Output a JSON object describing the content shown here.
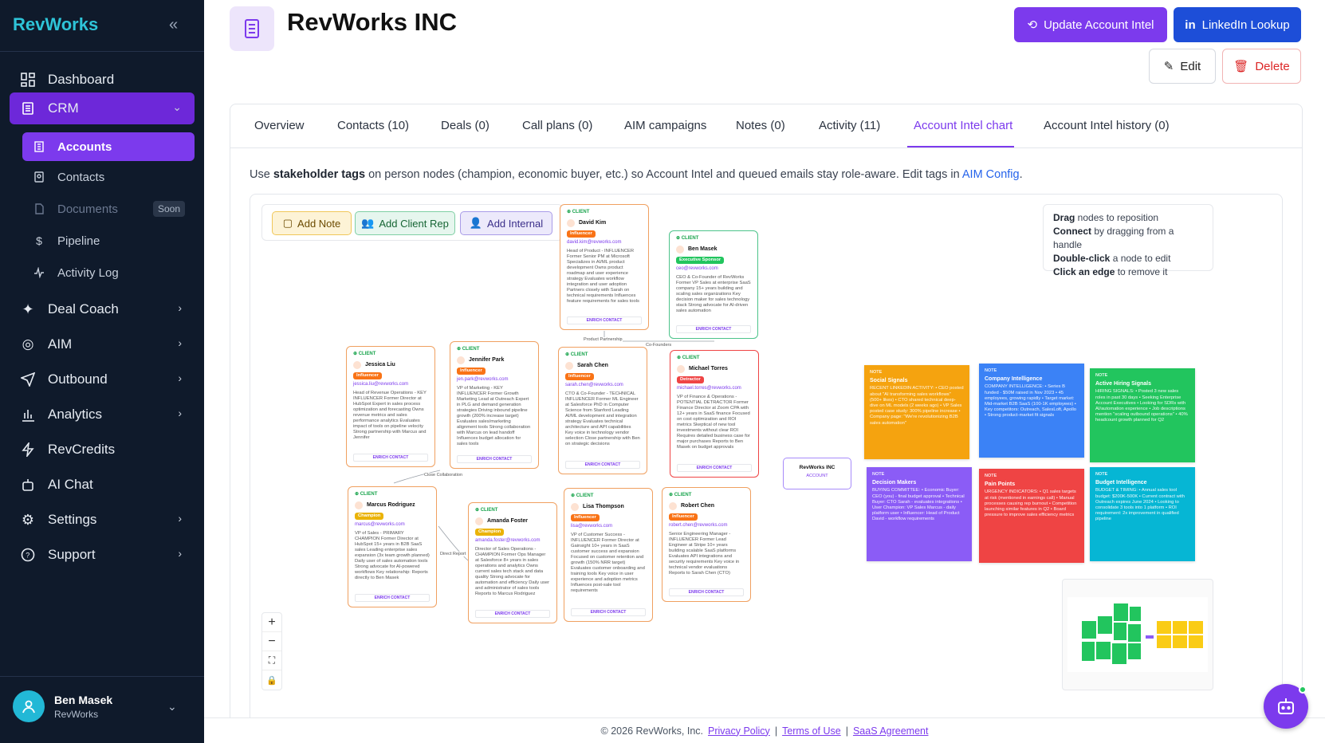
{
  "app": {
    "name": "RevWorks",
    "collapse_icon": "chevrons-left-icon"
  },
  "sidebar": {
    "items": [
      {
        "label": "Dashboard",
        "icon": "dashboard-icon"
      },
      {
        "label": "CRM",
        "icon": "crm-icon",
        "expanded": true
      },
      {
        "label": "Deal Coach",
        "icon": "sparkles-icon"
      },
      {
        "label": "AIM",
        "icon": "aim-icon"
      },
      {
        "label": "Outbound",
        "icon": "send-icon"
      },
      {
        "label": "Analytics",
        "icon": "bar-chart-icon"
      },
      {
        "label": "RevCredits",
        "icon": "bolt-icon"
      },
      {
        "label": "AI Chat",
        "icon": "bot-icon"
      },
      {
        "label": "Settings",
        "icon": "gear-icon"
      },
      {
        "label": "Support",
        "icon": "help-circle-icon"
      }
    ],
    "crm_sub": [
      {
        "label": "Accounts",
        "active": true
      },
      {
        "label": "Contacts"
      },
      {
        "label": "Documents",
        "badge": "Soon"
      },
      {
        "label": "Pipeline"
      },
      {
        "label": "Activity Log"
      }
    ],
    "user": {
      "name": "Ben Masek",
      "org": "RevWorks"
    }
  },
  "header": {
    "title": "RevWorks INC",
    "update_btn": "Update Account Intel",
    "linkedin_btn": "LinkedIn Lookup",
    "edit_btn": "Edit",
    "delete_btn": "Delete"
  },
  "tabs": [
    "Overview",
    "Contacts (10)",
    "Deals (0)",
    "Call plans (0)",
    "AIM campaigns",
    "Notes (0)",
    "Activity (11)",
    "Account Intel chart",
    "Account Intel history (0)"
  ],
  "active_tab": "Account Intel chart",
  "description": {
    "pre": "Use ",
    "bold": "stakeholder tags",
    "mid": " on person nodes (champion, economic buyer, etc.) so Account Intel and queued emails stay role-aware. Edit tags in ",
    "link": "AIM Config",
    "post": "."
  },
  "toolbar": {
    "add_note": "Add Note",
    "add_client": "Add Client Rep",
    "add_internal": "Add Internal"
  },
  "help": {
    "l1b": "Drag",
    "l1": " nodes to reposition",
    "l2b": "Connect",
    "l2": " by dragging from a handle",
    "l3b": "Double-click",
    "l3": " a node to edit",
    "l4b": "Click an edge",
    "l4": " to remove it"
  },
  "account_node": {
    "name": "RevWorks INC",
    "label": "ACCOUNT"
  },
  "edges": {
    "product_partnership": "Product Partnership",
    "co_founders": "Co-Founders",
    "close_collab": "Close Collaboration",
    "direct_report": "Direct Report"
  },
  "nodes": {
    "david": {
      "tag": "CLIENT",
      "name": "David Kim",
      "role": "Influencer",
      "email": "david.kim@revworks.com",
      "body": "Head of Product - INFLUENCER Former Senior PM at Microsoft Specializes in AI/ML product development Owns product roadmap and user experience strategy Evaluates workflow integration and user adoption Partners closely with Sarah on technical requirements Influences feature requirements for sales tools",
      "enrich": "ENRICH CONTACT"
    },
    "ben": {
      "tag": "CLIENT",
      "name": "Ben Masek",
      "role": "Executive Sponsor",
      "email": "ceo@revworks.com",
      "body": "CEO & Co-Founder of RevWorks Former VP Sales at enterprise SaaS company 15+ years building and scaling sales organizations Key decision maker for sales technology stack Strong advocate for AI-driven sales automation",
      "enrich": "ENRICH CONTACT"
    },
    "jessica": {
      "tag": "CLIENT",
      "name": "Jessica Liu",
      "role": "Influencer",
      "email": "jessica.liu@revworks.com",
      "body": "Head of Revenue Operations - KEY INFLUENCER Former Director at HubSpot Expert in sales process optimization and forecasting Owns revenue metrics and sales performance analytics Evaluates impact of tools on pipeline velocity Strong partnership with Marcus and Jennifer",
      "enrich": "ENRICH CONTACT"
    },
    "jennifer": {
      "tag": "CLIENT",
      "name": "Jennifer Park",
      "role": "Influencer",
      "email": "jen.park@revworks.com",
      "body": "VP of Marketing - KEY INFLUENCER Former Growth Marketing Lead at Outreach Expert in PLG and demand generation strategies Driving inbound pipeline growth (200% increase target) Evaluates sales/marketing alignment tools Strong collaboration with Marcus on lead handoff Influences budget allocation for sales tools",
      "enrich": "ENRICH CONTACT"
    },
    "sarah": {
      "tag": "CLIENT",
      "name": "Sarah Chen",
      "role": "Influencer",
      "email": "sarah.chen@revworks.com",
      "body": "CTO & Co-Founder - TECHNICAL INFLUENCER Former ML Engineer at Salesforce PhD in Computer Science from Stanford Leading AI/ML development and integration strategy Evaluates technical architecture and API capabilities Key voice in technology vendor selection Close partnership with Ben on strategic decisions",
      "enrich": "ENRICH CONTACT"
    },
    "michael": {
      "tag": "CLIENT",
      "name": "Michael Torres",
      "role": "Detractor",
      "email": "michael.torres@revworks.com",
      "body": "VP of Finance & Operations - POTENTIAL DETRACTOR Former Finance Director at Zoom CPA with 12+ years in SaaS finance Focused on cost optimization and ROI metrics Skeptical of new tool investments without clear ROI Requires detailed business case for major purchases Reports to Ben Masek on budget approvals",
      "enrich": "ENRICH CONTACT"
    },
    "marcus": {
      "tag": "CLIENT",
      "name": "Marcus Rodriguez",
      "role": "Champion",
      "email": "marcus@revworks.com",
      "body": "VP of Sales - PRIMARY CHAMPION Former Director at HubSpot 15+ years in B2B SaaS sales Leading enterprise sales expansion (3x team growth planned) Daily user of sales automation tools Strong advocate for AI-powered workflows Key relationship: Reports directly to Ben Masek",
      "enrich": "ENRICH CONTACT"
    },
    "amanda": {
      "tag": "CLIENT",
      "name": "Amanda Foster",
      "role": "Champion",
      "email": "amanda.foster@revworks.com",
      "body": "Director of Sales Operations - CHAMPION Former Ops Manager at Salesforce 8+ years in sales operations and analytics Owns current sales tech stack and data quality Strong advocate for automation and efficiency Daily user and administrator of sales tools Reports to Marcus Rodriguez",
      "enrich": "ENRICH CONTACT"
    },
    "lisa": {
      "tag": "CLIENT",
      "name": "Lisa Thompson",
      "role": "Influencer",
      "email": "lisa@revworks.com",
      "body": "VP of Customer Success - INFLUENCER Former Director at Gainsight 10+ years in SaaS customer success and expansion Focused on customer retention and growth (150% NRR target) Evaluates customer onboarding and training tools Key voice in user experience and adoption metrics Influences post-sale tool requirements",
      "enrich": "ENRICH CONTACT"
    },
    "robert": {
      "tag": "CLIENT",
      "name": "Robert Chen",
      "role": "Influencer",
      "email": "robert.chen@revworks.com",
      "body": "Senior Engineering Manager - INFLUENCER Former Lead Engineer at Stripe 10+ years building scalable SaaS platforms Evaluates API integrations and security requirements Key voice in technical vendor evaluations Reports to Sarah Chen (CTO)",
      "enrich": "ENRICH CONTACT"
    }
  },
  "notes": [
    {
      "tag": "NOTE",
      "title": "Social Signals",
      "color": "#f5a30f",
      "body": "RECENT LINKEDIN ACTIVITY: • CEO posted about \"AI transforming sales workflows\" (500+ likes) • CTO shared technical deep-dive on ML models (2 weeks ago) • VP Sales posted case study: 300% pipeline increase • Company page: \"We're revolutionizing B2B sales automation\""
    },
    {
      "tag": "NOTE",
      "title": "Company Intelligence",
      "color": "#3b82f6",
      "body": "COMPANY INTELLIGENCE: • Series B funded - $50M raised in Nov 2023 • 45 employees, growing rapidly • Target market: Mid-market B2B SaaS (100-1K employees) • Key competitors: Outreach, SalesLoft, Apollo • Strong product-market fit signals"
    },
    {
      "tag": "NOTE",
      "title": "Active Hiring Signals",
      "color": "#22c55e",
      "body": "HIRING SIGNALS: • Posted 3 new sales roles in past 30 days • Seeking Enterprise Account Executives • Looking for SDRs with AI/automation experience • Job descriptions mention \"scaling outbound operations\" • 40% headcount growth planned for Q2"
    },
    {
      "tag": "NOTE",
      "title": "Decision Makers",
      "color": "#8b5cf6",
      "body": "BUYING COMMITTEE: • Economic Buyer: CEO (you) - final budget approval • Technical Buyer: CTO Sarah - evaluates integrations • User Champion: VP Sales Marcus - daily platform user • Influencer: Head of Product David - workflow requirements"
    },
    {
      "tag": "NOTE",
      "title": "Pain Points",
      "color": "#ef4444",
      "body": "URGENCY INDICATORS: • Q1 sales targets at risk (mentioned in earnings call) • Manual processes causing rep burnout • Competition launching similar features in Q2 • Board pressure to improve sales efficiency metrics"
    },
    {
      "tag": "NOTE",
      "title": "Budget Intelligence",
      "color": "#06b6d4",
      "body": "BUDGET & TIMING: • Annual sales tool budget: $200K-500K • Current contract with Outreach expires June 2024 • Looking to consolidate 3 tools into 1 platform • ROI requirement: 2x improvement in qualified pipeline"
    }
  ],
  "footer": {
    "copy": "© 2026 RevWorks, Inc.",
    "privacy": "Privacy Policy",
    "terms": "Terms of Use",
    "saas": "SaaS Agreement",
    "sep": "|"
  }
}
